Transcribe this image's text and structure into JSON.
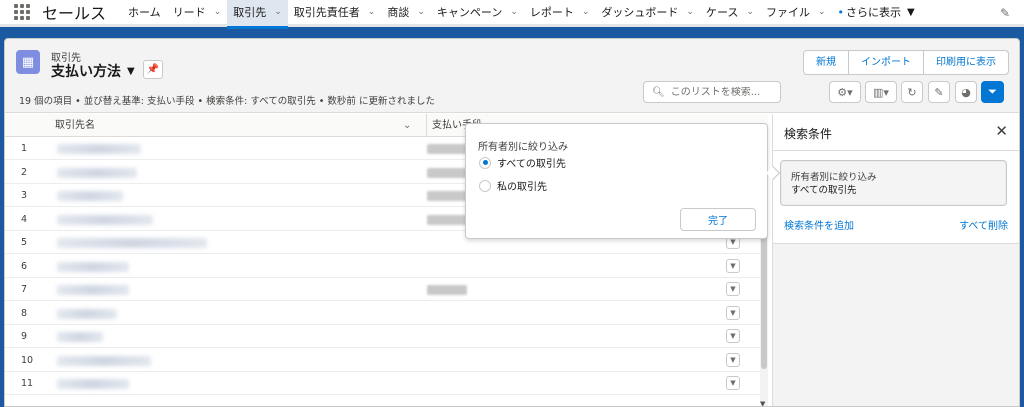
{
  "app": {
    "name": "セールス"
  },
  "nav": {
    "items": [
      {
        "label": "ホーム",
        "chevron": false
      },
      {
        "label": "リード",
        "chevron": true
      },
      {
        "label": "取引先",
        "chevron": true,
        "active": true
      },
      {
        "label": "取引先責任者",
        "chevron": true
      },
      {
        "label": "商談",
        "chevron": true
      },
      {
        "label": "キャンペーン",
        "chevron": true
      },
      {
        "label": "レポート",
        "chevron": true
      },
      {
        "label": "ダッシュボード",
        "chevron": true
      },
      {
        "label": "ケース",
        "chevron": true
      },
      {
        "label": "ファイル",
        "chevron": true
      }
    ],
    "more_label": "さらに表示"
  },
  "header": {
    "object_label": "取引先",
    "list_title": "支払い方法",
    "status": "19 個の項目 • 並び替え基準: 支払い手段 • 検索条件: すべての取引先 • 数秒前 に更新されました",
    "buttons": [
      "新規",
      "インポート",
      "印刷用に表示"
    ],
    "search_placeholder": "このリストを検索..."
  },
  "table": {
    "columns": [
      "取引先名",
      "支払い手段"
    ],
    "row_numbers": [
      "1",
      "2",
      "3",
      "4",
      "5",
      "6",
      "7",
      "8",
      "9",
      "10",
      "11"
    ]
  },
  "popover": {
    "title": "所有者別に絞り込み",
    "options": [
      {
        "label": "すべての取引先",
        "selected": true
      },
      {
        "label": "私の取引先",
        "selected": false
      }
    ],
    "done_label": "完了"
  },
  "filter_panel": {
    "title": "検索条件",
    "filter_label": "所有者別に絞り込み",
    "filter_value": "すべての取引先",
    "add_label": "検索条件を追加",
    "remove_label": "すべて削除"
  },
  "colors": {
    "accent": "#0176d3",
    "object_icon": "#7f8de1"
  }
}
